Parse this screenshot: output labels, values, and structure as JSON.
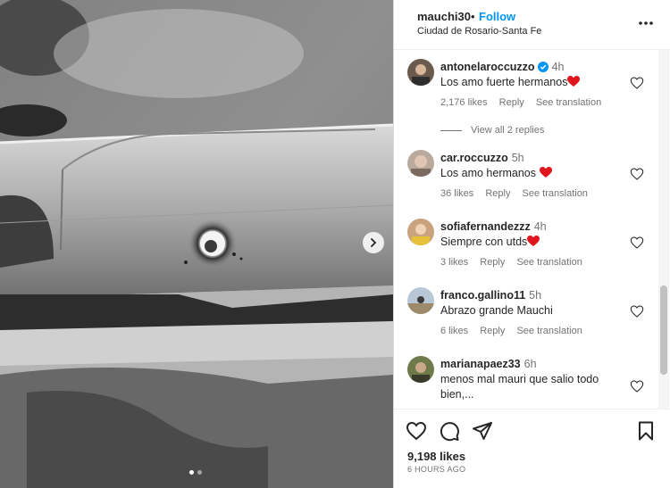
{
  "post": {
    "username": "mauchi30",
    "separator": "•",
    "follow_label": "Follow",
    "location": "Ciudad de Rosario-Santa Fe",
    "likes": "9,198 likes",
    "time_ago": "6 HOURS AGO",
    "carousel_current": 1,
    "carousel_total": 2
  },
  "comments": [
    {
      "username": "antonelaroccuzzo",
      "verified": true,
      "time": "4h",
      "text": "Los amo fuerte hermanos",
      "has_heart_emoji": true,
      "likes": "2,176 likes",
      "reply": "Reply",
      "translation": "See translation",
      "view_replies": "View all 2 replies"
    },
    {
      "username": "car.roccuzzo",
      "verified": false,
      "time": "5h",
      "text": "Los amo hermanos",
      "has_heart_emoji": true,
      "likes": "36 likes",
      "reply": "Reply",
      "translation": "See translation"
    },
    {
      "username": "sofiafernandezzz",
      "verified": false,
      "time": "4h",
      "text": "Siempre con utds",
      "has_heart_emoji": true,
      "likes": "3 likes",
      "reply": "Reply",
      "translation": "See translation"
    },
    {
      "username": "franco.gallino11",
      "verified": false,
      "time": "5h",
      "text": "Abrazo grande Mauchi",
      "has_heart_emoji": false,
      "likes": "6 likes",
      "reply": "Reply",
      "translation": "See translation"
    },
    {
      "username": "marianapaez33",
      "verified": false,
      "time": "6h",
      "text": "menos mal mauri que salio todo bien,...",
      "has_heart_emoji": false
    }
  ],
  "colors": {
    "link_blue": "#0095f6",
    "verified_blue": "#0095f6",
    "heart_red": "#e0161e",
    "text_primary": "#262626",
    "text_secondary": "#737373"
  },
  "icons": [
    "next-arrow-icon",
    "more-options-icon",
    "verified-badge-icon",
    "heart-icon",
    "comment-icon",
    "share-icon",
    "save-bookmark-icon"
  ]
}
